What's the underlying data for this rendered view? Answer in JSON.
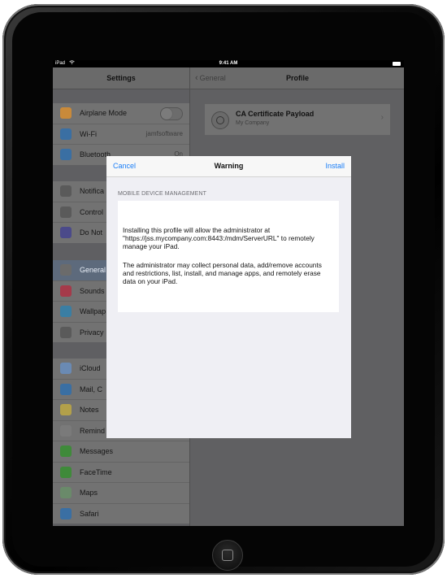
{
  "status_bar": {
    "device": "iPad",
    "time": "9:41 AM"
  },
  "settings": {
    "title": "Settings",
    "groups": [
      [
        {
          "label": "Airplane Mode",
          "color": "#c98a3a",
          "control": "toggle"
        },
        {
          "label": "Wi-Fi",
          "value": "jamfsoftware",
          "color": "#3a6fa3"
        },
        {
          "label": "Bluetooth",
          "value": "On",
          "color": "#3a6fa3"
        }
      ],
      [
        {
          "label": "Notifica",
          "color": "#5a5a5a"
        },
        {
          "label": "Control",
          "color": "#5a5a5a"
        },
        {
          "label": "Do Not",
          "color": "#4b4a8a"
        }
      ],
      [
        {
          "label": "General",
          "color": "#6b6b6b",
          "selected": true
        },
        {
          "label": "Sounds",
          "color": "#a53a4a"
        },
        {
          "label": "Wallpap",
          "color": "#3a7ea3"
        },
        {
          "label": "Privacy",
          "color": "#5a5a5a"
        }
      ],
      [
        {
          "label": "iCloud",
          "color": "#6a8ab3"
        },
        {
          "label": "Mail, C",
          "color": "#3a6fa3"
        },
        {
          "label": "Notes",
          "color": "#b3a04a"
        },
        {
          "label": "Remind",
          "color": "#7a7a7a"
        },
        {
          "label": "Messages",
          "color": "#3f8a3a"
        },
        {
          "label": "FaceTime",
          "color": "#3f8a3a"
        },
        {
          "label": "Maps",
          "color": "#6a8a6a"
        },
        {
          "label": "Safari",
          "color": "#3a6fa3"
        }
      ]
    ]
  },
  "profile": {
    "back_label": "General",
    "title": "Profile",
    "cert_title": "CA Certificate Payload",
    "cert_subtitle": "My Company"
  },
  "modal": {
    "cancel_label": "Cancel",
    "title": "Warning",
    "install_label": "Install",
    "section_label": "MOBILE DEVICE MANAGEMENT",
    "paragraph1": "Installing this profile will allow the administrator at \"https://jss.mycompany.com:8443:/mdm/ServerURL\" to remotely manage your iPad.",
    "paragraph2": "The administrator may collect personal data, add/remove accounts and restrictions, list, install, and manage apps, and remotely erase data on your iPad."
  }
}
